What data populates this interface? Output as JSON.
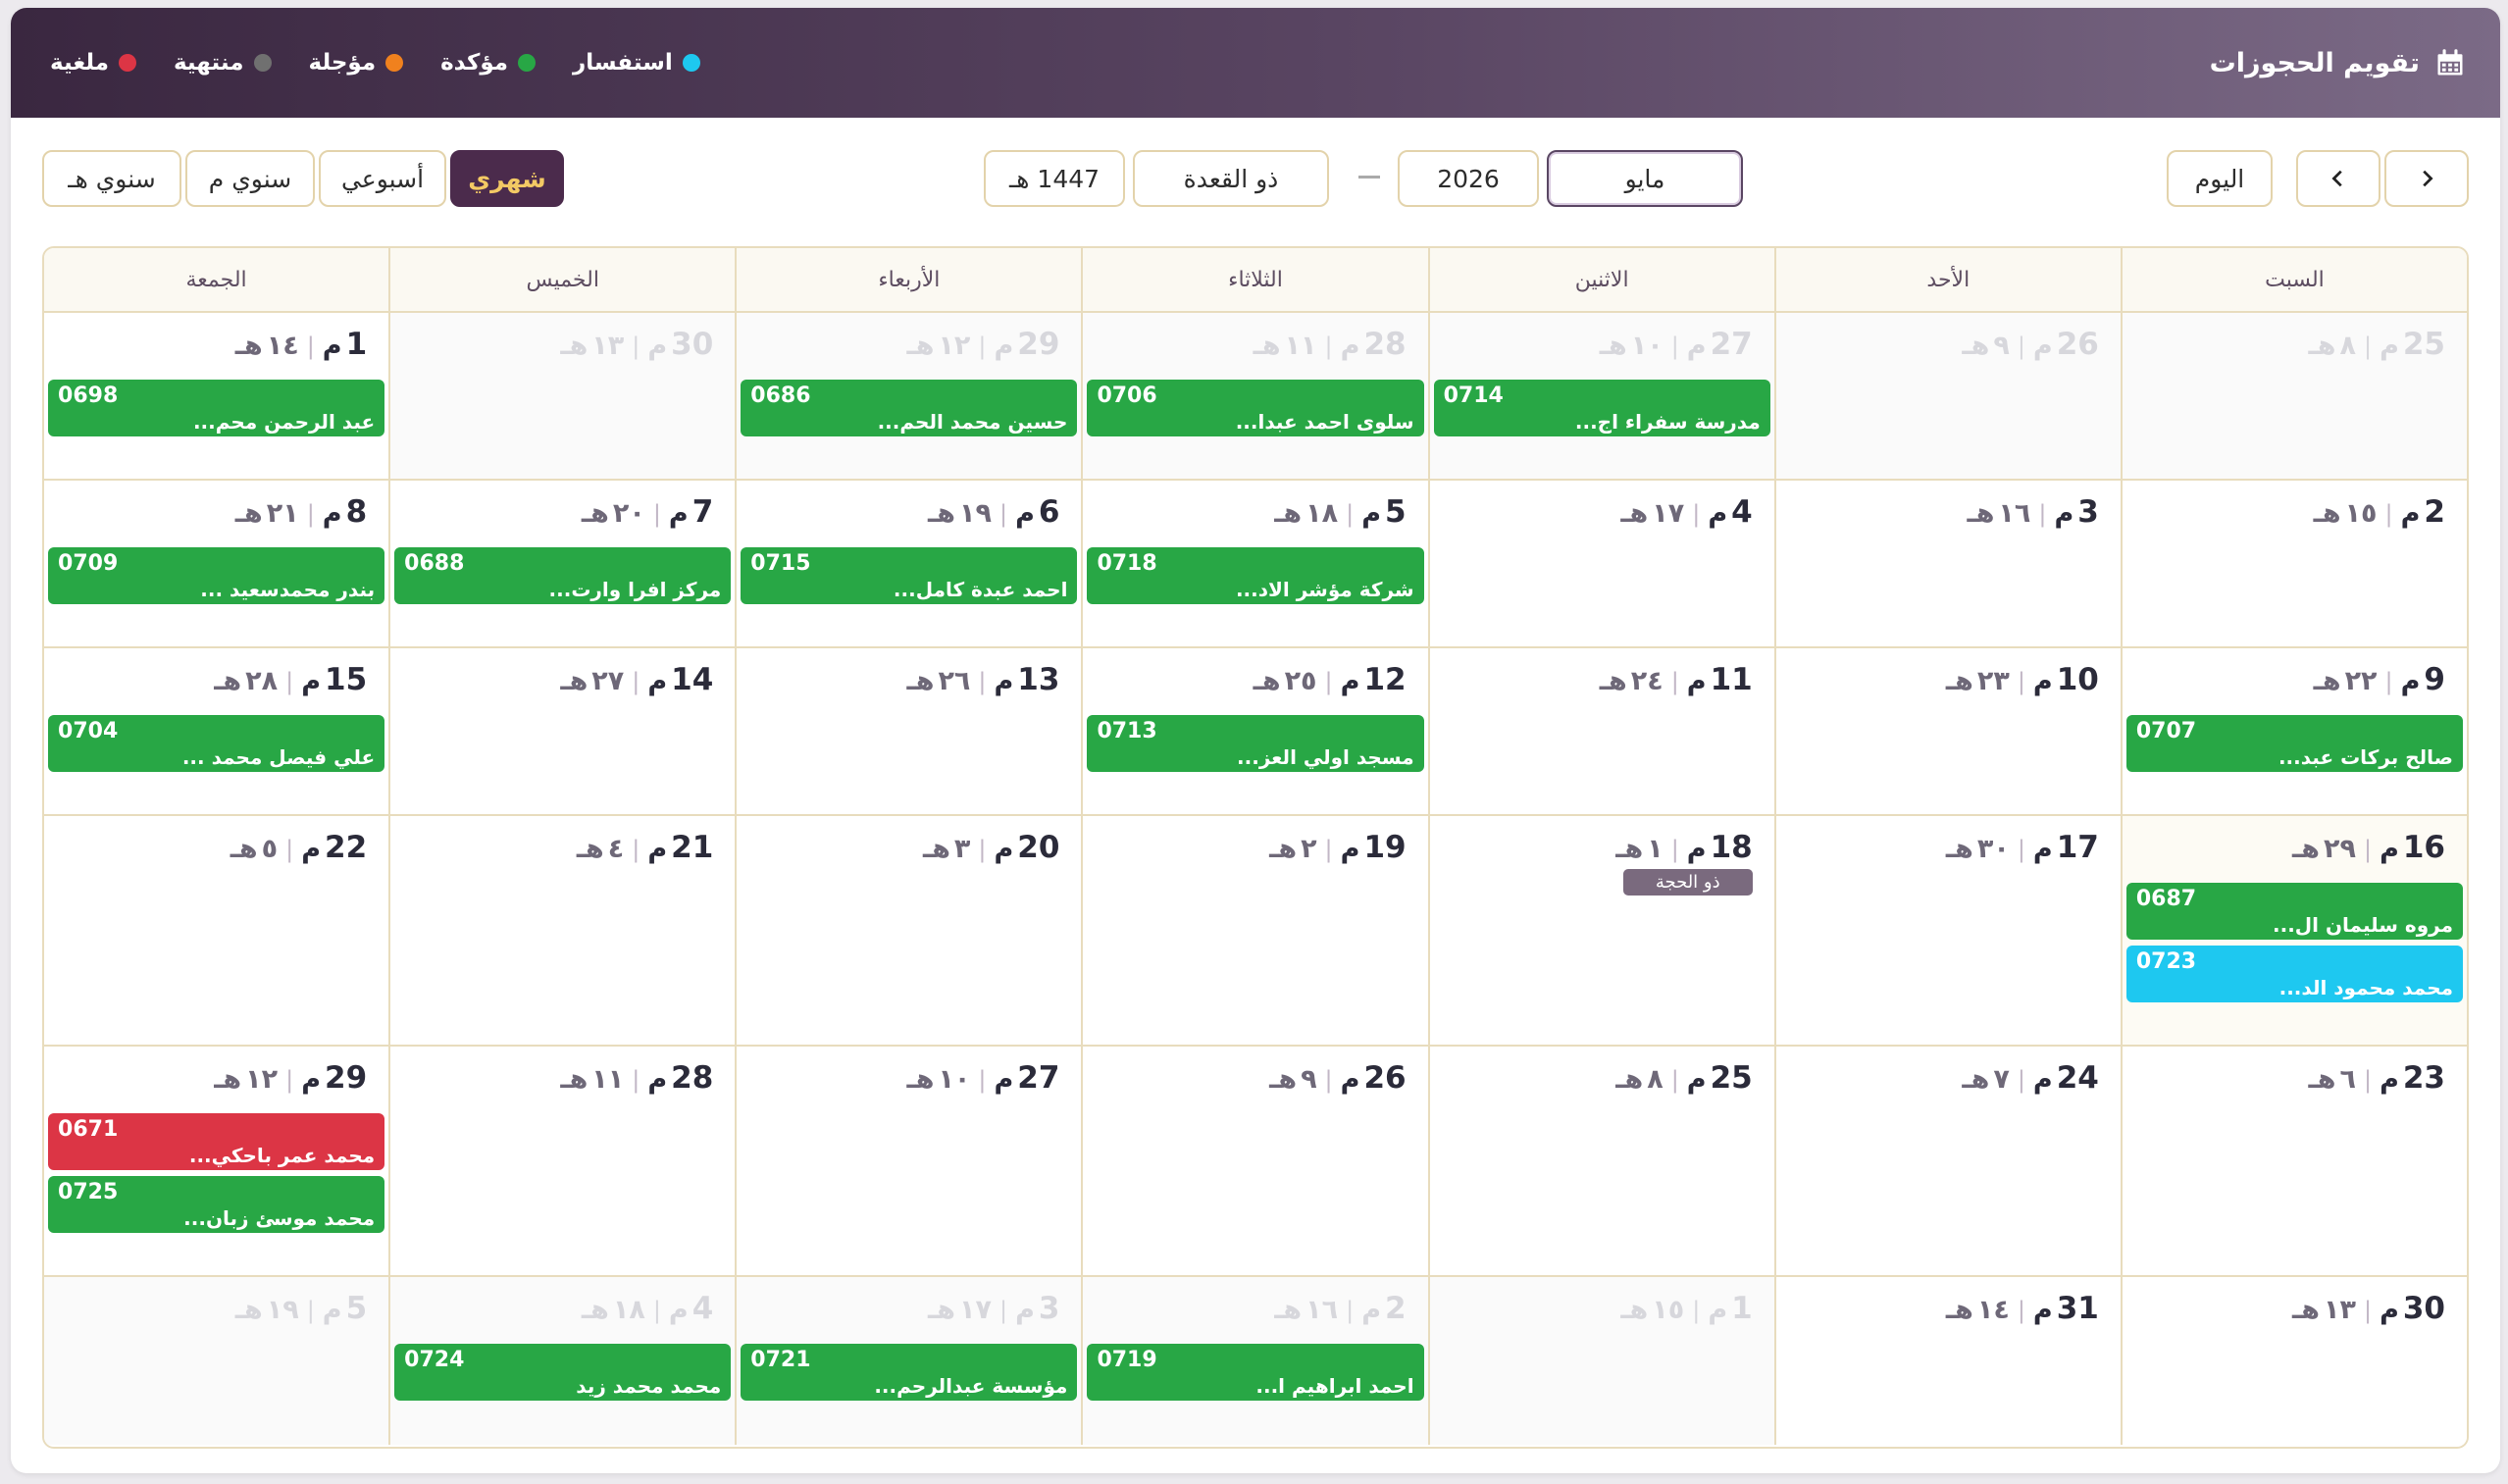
{
  "header": {
    "title": "تقويم الحجوزات",
    "icon": "calendar-icon",
    "gradient": [
      "#7b6a86",
      "#3a2740"
    ]
  },
  "legend": [
    {
      "label": "استفسار",
      "color": "#1ec8f0"
    },
    {
      "label": "مؤكدة",
      "color": "#28a745"
    },
    {
      "label": "مؤجلة",
      "color": "#f0811e"
    },
    {
      "label": "منتهية",
      "color": "#707070"
    },
    {
      "label": "ملغية",
      "color": "#dc3545"
    }
  ],
  "toolbar": {
    "today_label": "اليوم",
    "month_value": "مايو",
    "year_value": "2026",
    "dash": "—",
    "hijri_month_value": "ذو القعدة",
    "hijri_year_value": "1447 هـ",
    "views": [
      {
        "label": "شهري",
        "active": true
      },
      {
        "label": "أسبوعي",
        "active": false
      },
      {
        "label": "سنوي م",
        "active": false
      },
      {
        "label": "سنوي هـ",
        "active": false
      }
    ]
  },
  "weekdays": [
    "السبت",
    "الأحد",
    "الاثنين",
    "الثلاثاء",
    "الأربعاء",
    "الخميس",
    "الجمعة"
  ],
  "status_colors": {
    "confirmed": "#28a745",
    "inquiry": "#1ec8f0",
    "cancelled": "#dc3545"
  },
  "weeks": [
    [
      {
        "g": "25",
        "h": "٨",
        "other": true,
        "events": []
      },
      {
        "g": "26",
        "h": "٩",
        "other": true,
        "events": []
      },
      {
        "g": "27",
        "h": "١٠",
        "other": true,
        "events": [
          {
            "code": "0714",
            "name": "مدرسة سفراء اج...",
            "status": "confirmed"
          }
        ]
      },
      {
        "g": "28",
        "h": "١١",
        "other": true,
        "events": [
          {
            "code": "0706",
            "name": "سلوى احمد عبدا...",
            "status": "confirmed"
          }
        ]
      },
      {
        "g": "29",
        "h": "١٢",
        "other": true,
        "events": [
          {
            "code": "0686",
            "name": "حسين محمد الحم...",
            "status": "confirmed"
          }
        ]
      },
      {
        "g": "30",
        "h": "١٣",
        "other": true,
        "events": []
      },
      {
        "g": "1",
        "h": "١٤",
        "other": false,
        "events": [
          {
            "code": "0698",
            "name": "عبد الرحمن محم...",
            "status": "confirmed"
          }
        ]
      }
    ],
    [
      {
        "g": "2",
        "h": "١٥",
        "events": []
      },
      {
        "g": "3",
        "h": "١٦",
        "events": []
      },
      {
        "g": "4",
        "h": "١٧",
        "events": []
      },
      {
        "g": "5",
        "h": "١٨",
        "events": [
          {
            "code": "0718",
            "name": "شركة مؤشر الاد...",
            "status": "confirmed"
          }
        ]
      },
      {
        "g": "6",
        "h": "١٩",
        "events": [
          {
            "code": "0715",
            "name": "احمد عبدة كامل...",
            "status": "confirmed"
          }
        ]
      },
      {
        "g": "7",
        "h": "٢٠",
        "events": [
          {
            "code": "0688",
            "name": "مركز افرا وارت...",
            "status": "confirmed"
          }
        ]
      },
      {
        "g": "8",
        "h": "٢١",
        "events": [
          {
            "code": "0709",
            "name": "بندر محمدسعيد ...",
            "status": "confirmed"
          }
        ]
      }
    ],
    [
      {
        "g": "9",
        "h": "٢٢",
        "events": [
          {
            "code": "0707",
            "name": "صالح بركات عبد...",
            "status": "confirmed"
          }
        ]
      },
      {
        "g": "10",
        "h": "٢٣",
        "events": []
      },
      {
        "g": "11",
        "h": "٢٤",
        "events": []
      },
      {
        "g": "12",
        "h": "٢٥",
        "events": [
          {
            "code": "0713",
            "name": "مسجد اولي العز...",
            "status": "confirmed"
          }
        ]
      },
      {
        "g": "13",
        "h": "٢٦",
        "events": []
      },
      {
        "g": "14",
        "h": "٢٧",
        "events": []
      },
      {
        "g": "15",
        "h": "٢٨",
        "events": [
          {
            "code": "0704",
            "name": "علي فيصل محمد ...",
            "status": "confirmed"
          }
        ]
      }
    ],
    [
      {
        "g": "16",
        "h": "٢٩",
        "today": true,
        "events": [
          {
            "code": "0687",
            "name": "مروه سليمان ال...",
            "status": "confirmed"
          },
          {
            "code": "0723",
            "name": "محمد محمود الد...",
            "status": "inquiry"
          }
        ]
      },
      {
        "g": "17",
        "h": "٣٠",
        "events": []
      },
      {
        "g": "18",
        "h": "١",
        "tag": "ذو الحجة",
        "events": []
      },
      {
        "g": "19",
        "h": "٢",
        "events": []
      },
      {
        "g": "20",
        "h": "٣",
        "events": []
      },
      {
        "g": "21",
        "h": "٤",
        "events": []
      },
      {
        "g": "22",
        "h": "٥",
        "events": []
      }
    ],
    [
      {
        "g": "23",
        "h": "٦",
        "events": []
      },
      {
        "g": "24",
        "h": "٧",
        "events": []
      },
      {
        "g": "25",
        "h": "٨",
        "events": []
      },
      {
        "g": "26",
        "h": "٩",
        "events": []
      },
      {
        "g": "27",
        "h": "١٠",
        "events": []
      },
      {
        "g": "28",
        "h": "١١",
        "events": []
      },
      {
        "g": "29",
        "h": "١٢",
        "events": [
          {
            "code": "0671",
            "name": "محمد عمر باحكي...",
            "status": "cancelled"
          },
          {
            "code": "0725",
            "name": "محمد موسئ زبان...",
            "status": "confirmed"
          }
        ]
      }
    ],
    [
      {
        "g": "30",
        "h": "١٣",
        "events": []
      },
      {
        "g": "31",
        "h": "١٤",
        "events": []
      },
      {
        "g": "1",
        "h": "١٥",
        "other": true,
        "events": []
      },
      {
        "g": "2",
        "h": "١٦",
        "other": true,
        "events": [
          {
            "code": "0719",
            "name": "احمد ابراهيم ا...",
            "status": "confirmed"
          }
        ]
      },
      {
        "g": "3",
        "h": "١٧",
        "other": true,
        "events": [
          {
            "code": "0721",
            "name": "مؤسسة عبدالرحم...",
            "status": "confirmed"
          }
        ]
      },
      {
        "g": "4",
        "h": "١٨",
        "other": true,
        "events": [
          {
            "code": "0724",
            "name": "محمد محمد زيد",
            "status": "confirmed"
          }
        ]
      },
      {
        "g": "5",
        "h": "١٩",
        "other": true,
        "events": []
      }
    ]
  ],
  "suffixes": {
    "g": "م",
    "h": "هـ",
    "sep": "|"
  }
}
